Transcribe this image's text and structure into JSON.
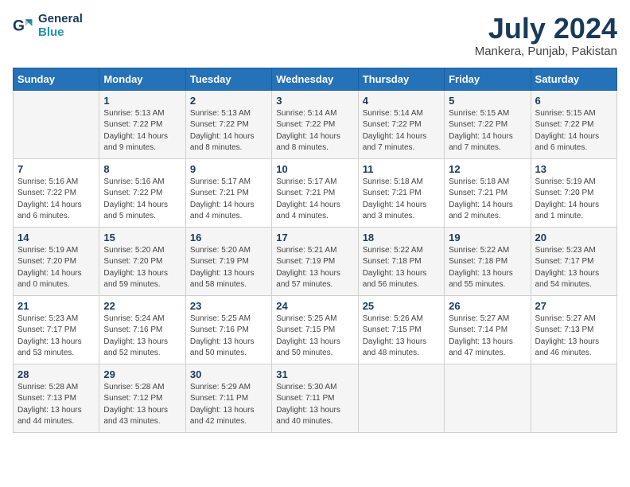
{
  "header": {
    "logo_general": "General",
    "logo_blue": "Blue",
    "month_title": "July 2024",
    "location": "Mankera, Punjab, Pakistan"
  },
  "days_of_week": [
    "Sunday",
    "Monday",
    "Tuesday",
    "Wednesday",
    "Thursday",
    "Friday",
    "Saturday"
  ],
  "weeks": [
    [
      {
        "day": "",
        "sunrise": "",
        "sunset": "",
        "daylight": ""
      },
      {
        "day": "1",
        "sunrise": "Sunrise: 5:13 AM",
        "sunset": "Sunset: 7:22 PM",
        "daylight": "Daylight: 14 hours and 9 minutes."
      },
      {
        "day": "2",
        "sunrise": "Sunrise: 5:13 AM",
        "sunset": "Sunset: 7:22 PM",
        "daylight": "Daylight: 14 hours and 8 minutes."
      },
      {
        "day": "3",
        "sunrise": "Sunrise: 5:14 AM",
        "sunset": "Sunset: 7:22 PM",
        "daylight": "Daylight: 14 hours and 8 minutes."
      },
      {
        "day": "4",
        "sunrise": "Sunrise: 5:14 AM",
        "sunset": "Sunset: 7:22 PM",
        "daylight": "Daylight: 14 hours and 7 minutes."
      },
      {
        "day": "5",
        "sunrise": "Sunrise: 5:15 AM",
        "sunset": "Sunset: 7:22 PM",
        "daylight": "Daylight: 14 hours and 7 minutes."
      },
      {
        "day": "6",
        "sunrise": "Sunrise: 5:15 AM",
        "sunset": "Sunset: 7:22 PM",
        "daylight": "Daylight: 14 hours and 6 minutes."
      }
    ],
    [
      {
        "day": "7",
        "sunrise": "Sunrise: 5:16 AM",
        "sunset": "Sunset: 7:22 PM",
        "daylight": "Daylight: 14 hours and 6 minutes."
      },
      {
        "day": "8",
        "sunrise": "Sunrise: 5:16 AM",
        "sunset": "Sunset: 7:22 PM",
        "daylight": "Daylight: 14 hours and 5 minutes."
      },
      {
        "day": "9",
        "sunrise": "Sunrise: 5:17 AM",
        "sunset": "Sunset: 7:21 PM",
        "daylight": "Daylight: 14 hours and 4 minutes."
      },
      {
        "day": "10",
        "sunrise": "Sunrise: 5:17 AM",
        "sunset": "Sunset: 7:21 PM",
        "daylight": "Daylight: 14 hours and 4 minutes."
      },
      {
        "day": "11",
        "sunrise": "Sunrise: 5:18 AM",
        "sunset": "Sunset: 7:21 PM",
        "daylight": "Daylight: 14 hours and 3 minutes."
      },
      {
        "day": "12",
        "sunrise": "Sunrise: 5:18 AM",
        "sunset": "Sunset: 7:21 PM",
        "daylight": "Daylight: 14 hours and 2 minutes."
      },
      {
        "day": "13",
        "sunrise": "Sunrise: 5:19 AM",
        "sunset": "Sunset: 7:20 PM",
        "daylight": "Daylight: 14 hours and 1 minute."
      }
    ],
    [
      {
        "day": "14",
        "sunrise": "Sunrise: 5:19 AM",
        "sunset": "Sunset: 7:20 PM",
        "daylight": "Daylight: 14 hours and 0 minutes."
      },
      {
        "day": "15",
        "sunrise": "Sunrise: 5:20 AM",
        "sunset": "Sunset: 7:20 PM",
        "daylight": "Daylight: 13 hours and 59 minutes."
      },
      {
        "day": "16",
        "sunrise": "Sunrise: 5:20 AM",
        "sunset": "Sunset: 7:19 PM",
        "daylight": "Daylight: 13 hours and 58 minutes."
      },
      {
        "day": "17",
        "sunrise": "Sunrise: 5:21 AM",
        "sunset": "Sunset: 7:19 PM",
        "daylight": "Daylight: 13 hours and 57 minutes."
      },
      {
        "day": "18",
        "sunrise": "Sunrise: 5:22 AM",
        "sunset": "Sunset: 7:18 PM",
        "daylight": "Daylight: 13 hours and 56 minutes."
      },
      {
        "day": "19",
        "sunrise": "Sunrise: 5:22 AM",
        "sunset": "Sunset: 7:18 PM",
        "daylight": "Daylight: 13 hours and 55 minutes."
      },
      {
        "day": "20",
        "sunrise": "Sunrise: 5:23 AM",
        "sunset": "Sunset: 7:17 PM",
        "daylight": "Daylight: 13 hours and 54 minutes."
      }
    ],
    [
      {
        "day": "21",
        "sunrise": "Sunrise: 5:23 AM",
        "sunset": "Sunset: 7:17 PM",
        "daylight": "Daylight: 13 hours and 53 minutes."
      },
      {
        "day": "22",
        "sunrise": "Sunrise: 5:24 AM",
        "sunset": "Sunset: 7:16 PM",
        "daylight": "Daylight: 13 hours and 52 minutes."
      },
      {
        "day": "23",
        "sunrise": "Sunrise: 5:25 AM",
        "sunset": "Sunset: 7:16 PM",
        "daylight": "Daylight: 13 hours and 50 minutes."
      },
      {
        "day": "24",
        "sunrise": "Sunrise: 5:25 AM",
        "sunset": "Sunset: 7:15 PM",
        "daylight": "Daylight: 13 hours and 50 minutes."
      },
      {
        "day": "25",
        "sunrise": "Sunrise: 5:26 AM",
        "sunset": "Sunset: 7:15 PM",
        "daylight": "Daylight: 13 hours and 48 minutes."
      },
      {
        "day": "26",
        "sunrise": "Sunrise: 5:27 AM",
        "sunset": "Sunset: 7:14 PM",
        "daylight": "Daylight: 13 hours and 47 minutes."
      },
      {
        "day": "27",
        "sunrise": "Sunrise: 5:27 AM",
        "sunset": "Sunset: 7:13 PM",
        "daylight": "Daylight: 13 hours and 46 minutes."
      }
    ],
    [
      {
        "day": "28",
        "sunrise": "Sunrise: 5:28 AM",
        "sunset": "Sunset: 7:13 PM",
        "daylight": "Daylight: 13 hours and 44 minutes."
      },
      {
        "day": "29",
        "sunrise": "Sunrise: 5:28 AM",
        "sunset": "Sunset: 7:12 PM",
        "daylight": "Daylight: 13 hours and 43 minutes."
      },
      {
        "day": "30",
        "sunrise": "Sunrise: 5:29 AM",
        "sunset": "Sunset: 7:11 PM",
        "daylight": "Daylight: 13 hours and 42 minutes."
      },
      {
        "day": "31",
        "sunrise": "Sunrise: 5:30 AM",
        "sunset": "Sunset: 7:11 PM",
        "daylight": "Daylight: 13 hours and 40 minutes."
      },
      {
        "day": "",
        "sunrise": "",
        "sunset": "",
        "daylight": ""
      },
      {
        "day": "",
        "sunrise": "",
        "sunset": "",
        "daylight": ""
      },
      {
        "day": "",
        "sunrise": "",
        "sunset": "",
        "daylight": ""
      }
    ]
  ]
}
